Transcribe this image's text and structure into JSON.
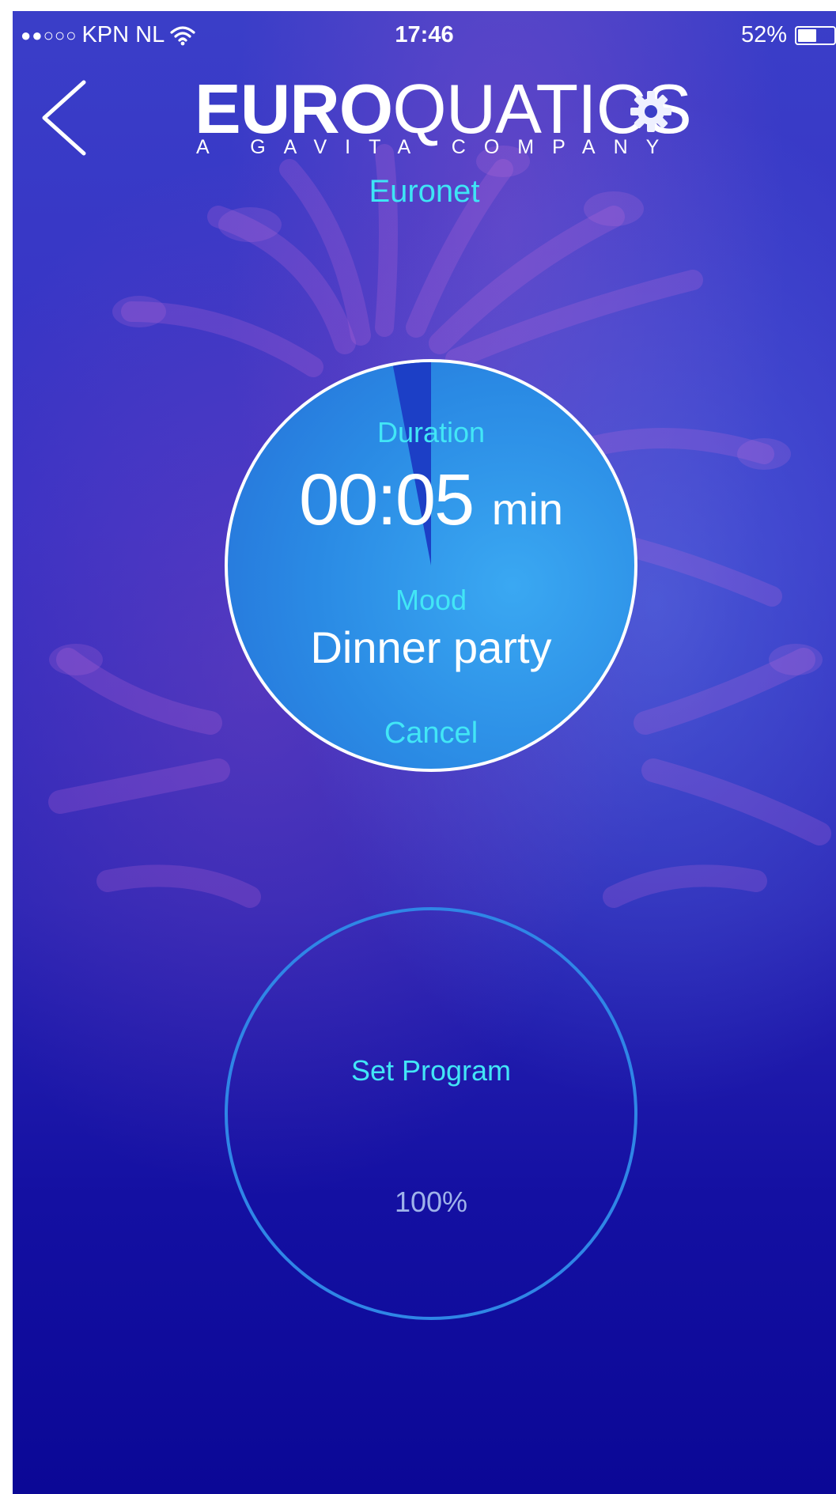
{
  "status_bar": {
    "signal": "●●○○○",
    "carrier": "KPN NL",
    "time": "17:46",
    "battery_text": "52%",
    "battery_level": 0.52
  },
  "header": {
    "logo_bold": "EURO",
    "logo_thin": "QUATICS",
    "logo_tagline": "A GAVITA COMPANY",
    "device_name": "Euronet",
    "back_icon": "chevron-left-icon",
    "settings_icon": "gear-icon"
  },
  "dial": {
    "duration_label": "Duration",
    "duration_value": "00:05",
    "duration_unit": "min",
    "mood_label": "Mood",
    "mood_value": "Dinner party",
    "cancel_label": "Cancel",
    "progress_fraction": 0.03
  },
  "program": {
    "label": "Set Program",
    "percent": "100%"
  },
  "colors": {
    "accent_cyan": "#42e6f6",
    "dial_blue": "#2a8ae4",
    "background_blue": "#2a25b5"
  }
}
